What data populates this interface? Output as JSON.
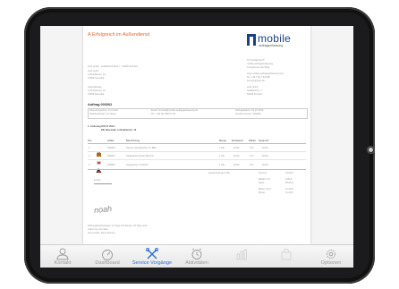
{
  "document": {
    "title": "A Erfolgreich im Außendienst",
    "logo": {
      "word": "mobile",
      "tagline": "auftragserfassung"
    },
    "sender_line": "ionic gmbh · Goldbachstrasse 7 · 50226 Frechen",
    "address_left": [
      "ionic gmbh",
      "Lohmühlenstr. 12",
      "07926 Neustadt"
    ],
    "address_left2": [
      "Lieferadresse",
      "Lohmühlenstr. 12",
      "07926 Neustadt"
    ],
    "address_right": [
      "Ihr Kontakt bei IT:",
      "mobile auftragserfassung",
      "Cornelia van der Berg",
      "",
      "www.mobile-auftragserfassung.com",
      "Tel. +49 7 62 7 62 995",
      "service@ionic.de",
      "",
      "ionic gmbh",
      "Goldbachstr. 7",
      "50226 Frechen"
    ],
    "order_title": "Auftrag 000002",
    "order_box": [
      [
        "Ansprechpartner: Ihr Kunde",
        "Email: Kontakt@mobile-auftragserfassung.de",
        "Auftragsdatum: 04.07.2013"
      ],
      [
        "Sachbearbeiter: Ihr Name",
        "Tel.: +49 711 658 57 29",
        "Kundennummer: 000283"
      ]
    ],
    "delivery": [
      "1. Lieferung   KW 27 2013 ·",
      "DB, Neustadt, Lohmühlenstr. 12"
    ],
    "table_headers": [
      "Pos",
      "Artikel",
      "Bezeichnung",
      "Menge",
      "Einzelpreis",
      "Rabatt",
      "Gesamt €"
    ],
    "rows": [
      {
        "pos": "1",
        "artikel": "000002",
        "bezeichnung": "Damen Handtaschen Yo BRO",
        "menge": "1 Stk.",
        "preis": "20,00",
        "rabatt": "0 %",
        "gesamt": "20,00"
      },
      {
        "pos": "2",
        "artikel": "000004",
        "bezeichnung": "Sargtasche Kinder BLACK",
        "menge": "1 Stk.",
        "preis": "20,00",
        "rabatt": "0 %",
        "gesamt": "20,00"
      },
      {
        "pos": "3",
        "artikel": "000005",
        "bezeichnung": "Sargtasche YN BLTR",
        "menge": "1 Stk.",
        "preis": "20,00",
        "rabatt": "0 %",
        "gesamt": "20,00"
      }
    ],
    "totals_label_left": "Gesamtmenge   3 Stk.",
    "totals": [
      [
        "Summe:",
        "70,00 €"
      ],
      [
        "Rabatt 0 %:",
        "0,00 €"
      ],
      [
        "Netto:",
        "60,00 €"
      ],
      [
        "MwSt. 19 %:",
        "11,40 €"
      ],
      [
        "Brutto:",
        "11,40 €"
      ]
    ],
    "signature_label": "Kunde",
    "signature_text": "noah",
    "footer": [
      "Zahlungsbedingungen: 14 Tage 2% Skonto, 30 Tage netto",
      "Lieferung: frei Haus",
      "Kommentar: keine Ahnung"
    ]
  },
  "tabbar": {
    "tabs": [
      {
        "label": "Kontakt",
        "icon": "person-icon",
        "state": "normal"
      },
      {
        "label": "Dashboard",
        "icon": "speedometer-icon",
        "state": "normal"
      },
      {
        "label": "Service Vorgänge",
        "icon": "tools-icon",
        "state": "active"
      },
      {
        "label": "Aktivitäten",
        "icon": "alarm-clock-icon",
        "state": "normal"
      },
      {
        "label": "",
        "icon": "chart-icon",
        "state": "disabled"
      },
      {
        "label": "",
        "icon": "bag-icon",
        "state": "disabled"
      },
      {
        "label": "Optionen",
        "icon": "gear-icon",
        "state": "normal"
      }
    ]
  },
  "colors": {
    "accent": "#2b6fd6",
    "title": "#e1662c",
    "brand": "#1d3f83"
  }
}
